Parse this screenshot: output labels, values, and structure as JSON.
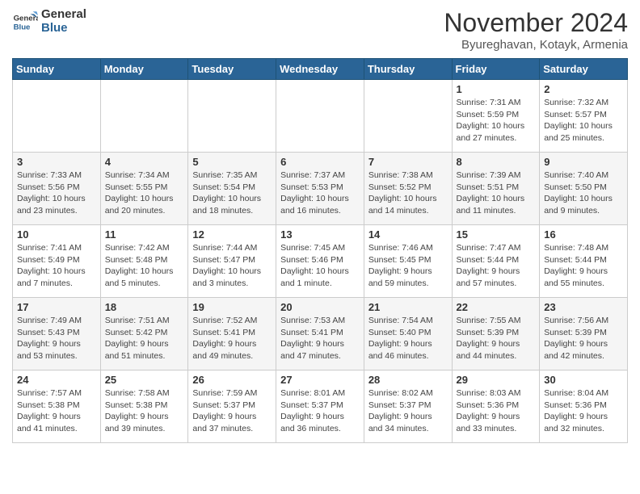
{
  "header": {
    "logo_general": "General",
    "logo_blue": "Blue",
    "month_title": "November 2024",
    "subtitle": "Byureghavan, Kotayk, Armenia"
  },
  "days_of_week": [
    "Sunday",
    "Monday",
    "Tuesday",
    "Wednesday",
    "Thursday",
    "Friday",
    "Saturday"
  ],
  "weeks": [
    [
      {
        "day": "",
        "info": ""
      },
      {
        "day": "",
        "info": ""
      },
      {
        "day": "",
        "info": ""
      },
      {
        "day": "",
        "info": ""
      },
      {
        "day": "",
        "info": ""
      },
      {
        "day": "1",
        "info": "Sunrise: 7:31 AM\nSunset: 5:59 PM\nDaylight: 10 hours and 27 minutes."
      },
      {
        "day": "2",
        "info": "Sunrise: 7:32 AM\nSunset: 5:57 PM\nDaylight: 10 hours and 25 minutes."
      }
    ],
    [
      {
        "day": "3",
        "info": "Sunrise: 7:33 AM\nSunset: 5:56 PM\nDaylight: 10 hours and 23 minutes."
      },
      {
        "day": "4",
        "info": "Sunrise: 7:34 AM\nSunset: 5:55 PM\nDaylight: 10 hours and 20 minutes."
      },
      {
        "day": "5",
        "info": "Sunrise: 7:35 AM\nSunset: 5:54 PM\nDaylight: 10 hours and 18 minutes."
      },
      {
        "day": "6",
        "info": "Sunrise: 7:37 AM\nSunset: 5:53 PM\nDaylight: 10 hours and 16 minutes."
      },
      {
        "day": "7",
        "info": "Sunrise: 7:38 AM\nSunset: 5:52 PM\nDaylight: 10 hours and 14 minutes."
      },
      {
        "day": "8",
        "info": "Sunrise: 7:39 AM\nSunset: 5:51 PM\nDaylight: 10 hours and 11 minutes."
      },
      {
        "day": "9",
        "info": "Sunrise: 7:40 AM\nSunset: 5:50 PM\nDaylight: 10 hours and 9 minutes."
      }
    ],
    [
      {
        "day": "10",
        "info": "Sunrise: 7:41 AM\nSunset: 5:49 PM\nDaylight: 10 hours and 7 minutes."
      },
      {
        "day": "11",
        "info": "Sunrise: 7:42 AM\nSunset: 5:48 PM\nDaylight: 10 hours and 5 minutes."
      },
      {
        "day": "12",
        "info": "Sunrise: 7:44 AM\nSunset: 5:47 PM\nDaylight: 10 hours and 3 minutes."
      },
      {
        "day": "13",
        "info": "Sunrise: 7:45 AM\nSunset: 5:46 PM\nDaylight: 10 hours and 1 minute."
      },
      {
        "day": "14",
        "info": "Sunrise: 7:46 AM\nSunset: 5:45 PM\nDaylight: 9 hours and 59 minutes."
      },
      {
        "day": "15",
        "info": "Sunrise: 7:47 AM\nSunset: 5:44 PM\nDaylight: 9 hours and 57 minutes."
      },
      {
        "day": "16",
        "info": "Sunrise: 7:48 AM\nSunset: 5:44 PM\nDaylight: 9 hours and 55 minutes."
      }
    ],
    [
      {
        "day": "17",
        "info": "Sunrise: 7:49 AM\nSunset: 5:43 PM\nDaylight: 9 hours and 53 minutes."
      },
      {
        "day": "18",
        "info": "Sunrise: 7:51 AM\nSunset: 5:42 PM\nDaylight: 9 hours and 51 minutes."
      },
      {
        "day": "19",
        "info": "Sunrise: 7:52 AM\nSunset: 5:41 PM\nDaylight: 9 hours and 49 minutes."
      },
      {
        "day": "20",
        "info": "Sunrise: 7:53 AM\nSunset: 5:41 PM\nDaylight: 9 hours and 47 minutes."
      },
      {
        "day": "21",
        "info": "Sunrise: 7:54 AM\nSunset: 5:40 PM\nDaylight: 9 hours and 46 minutes."
      },
      {
        "day": "22",
        "info": "Sunrise: 7:55 AM\nSunset: 5:39 PM\nDaylight: 9 hours and 44 minutes."
      },
      {
        "day": "23",
        "info": "Sunrise: 7:56 AM\nSunset: 5:39 PM\nDaylight: 9 hours and 42 minutes."
      }
    ],
    [
      {
        "day": "24",
        "info": "Sunrise: 7:57 AM\nSunset: 5:38 PM\nDaylight: 9 hours and 41 minutes."
      },
      {
        "day": "25",
        "info": "Sunrise: 7:58 AM\nSunset: 5:38 PM\nDaylight: 9 hours and 39 minutes."
      },
      {
        "day": "26",
        "info": "Sunrise: 7:59 AM\nSunset: 5:37 PM\nDaylight: 9 hours and 37 minutes."
      },
      {
        "day": "27",
        "info": "Sunrise: 8:01 AM\nSunset: 5:37 PM\nDaylight: 9 hours and 36 minutes."
      },
      {
        "day": "28",
        "info": "Sunrise: 8:02 AM\nSunset: 5:37 PM\nDaylight: 9 hours and 34 minutes."
      },
      {
        "day": "29",
        "info": "Sunrise: 8:03 AM\nSunset: 5:36 PM\nDaylight: 9 hours and 33 minutes."
      },
      {
        "day": "30",
        "info": "Sunrise: 8:04 AM\nSunset: 5:36 PM\nDaylight: 9 hours and 32 minutes."
      }
    ]
  ]
}
